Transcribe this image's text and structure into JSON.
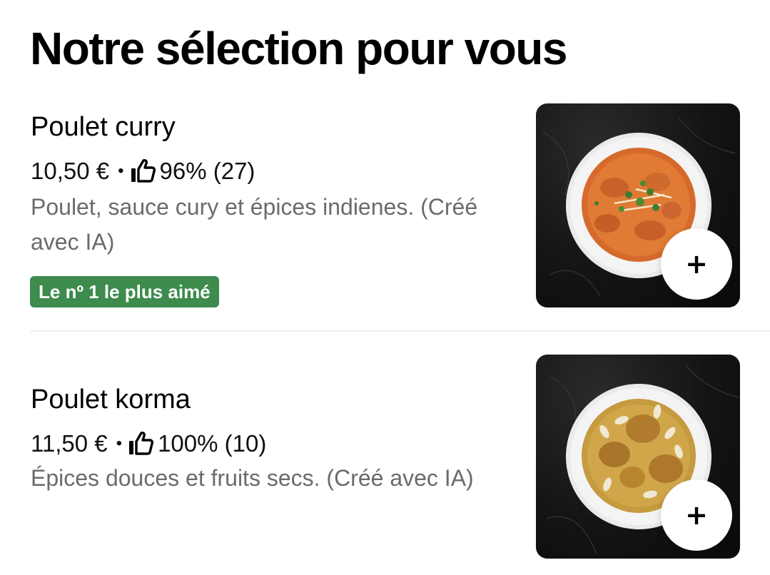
{
  "section": {
    "title": "Notre sélection pour vous"
  },
  "items": [
    {
      "name": "Poulet curry",
      "price": "10,50 €",
      "separator": "•",
      "rating_icon": "thumbs-up-icon",
      "rating": "96% (27)",
      "description": "Poulet, sauce cury et épices indienes. (Créé avec IA)",
      "badge": "Le nº 1 le plus aimé",
      "badge_color": "#3d8b4d",
      "add_label": "+"
    },
    {
      "name": "Poulet korma",
      "price": "11,50 €",
      "separator": "•",
      "rating_icon": "thumbs-up-icon",
      "rating": "100% (10)",
      "description": "Épices douces et fruits secs. (Créé avec IA)",
      "add_label": "+"
    }
  ]
}
